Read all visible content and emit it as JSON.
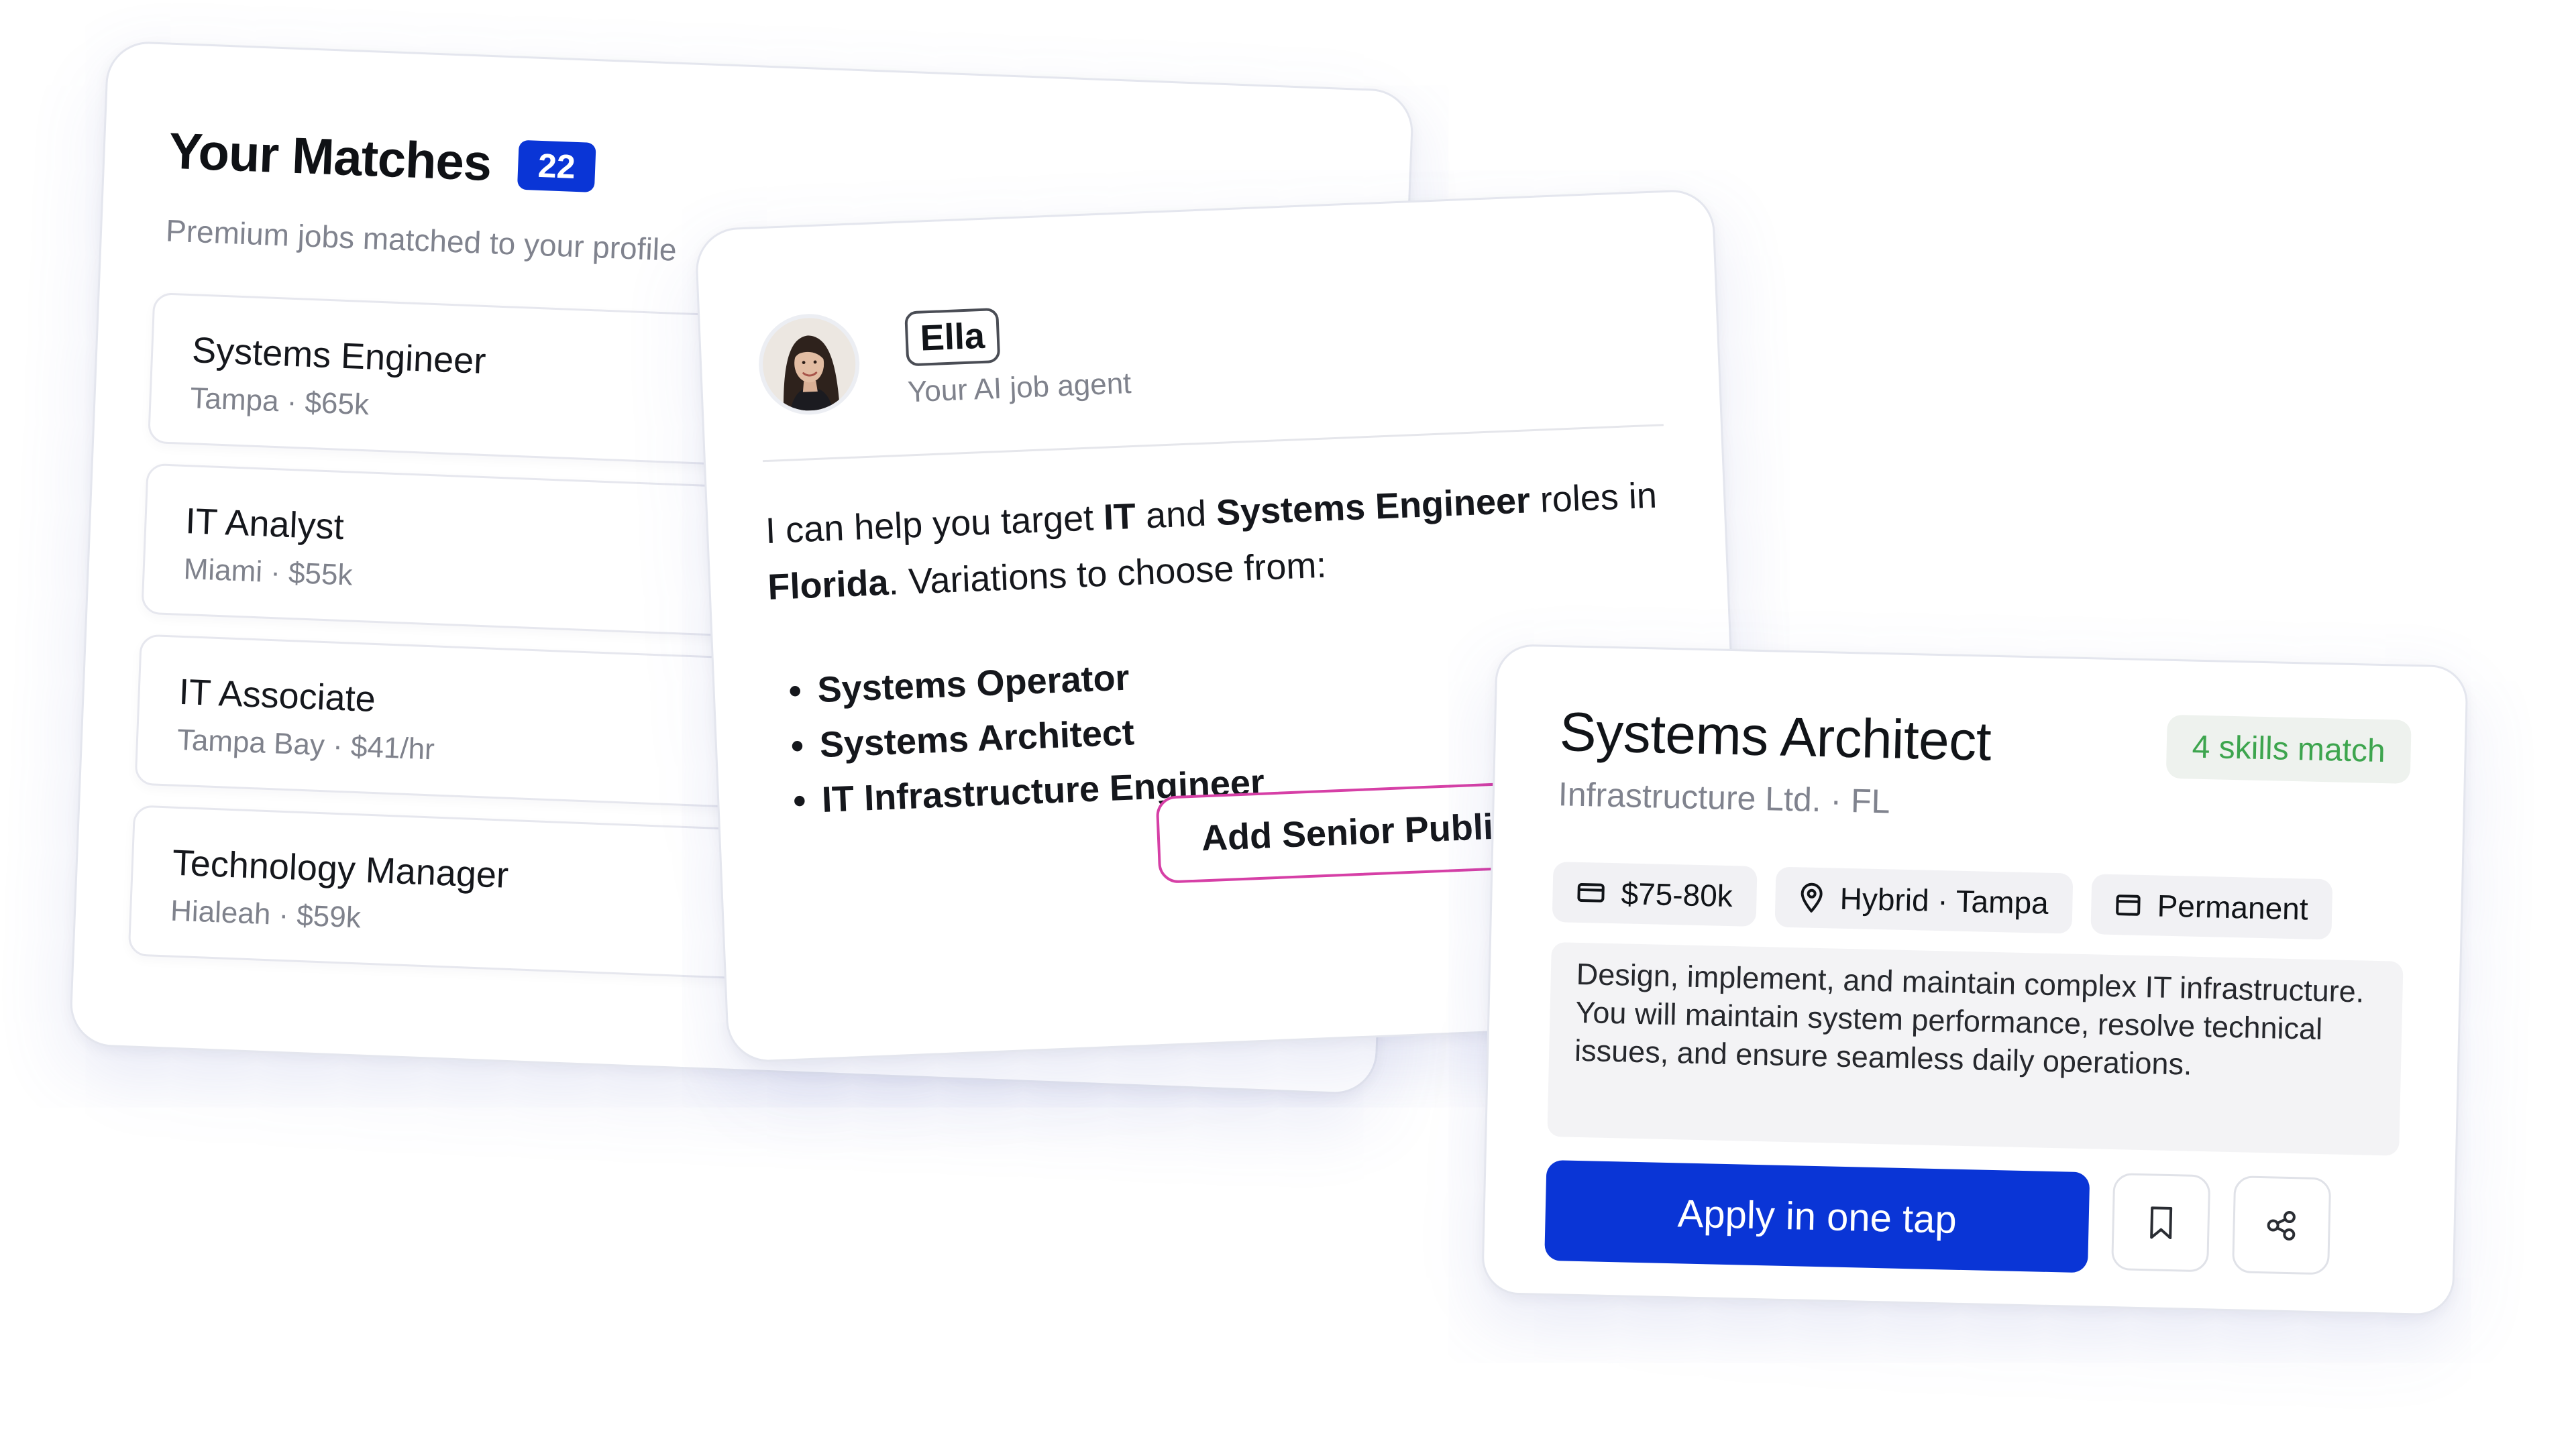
{
  "matches": {
    "title": "Your Matches",
    "count": "22",
    "subtitle": "Premium jobs matched to your profile",
    "items": [
      {
        "title": "Systems Engineer",
        "meta": "Tampa · $65k"
      },
      {
        "title": "IT Analyst",
        "meta": "Miami · $55k"
      },
      {
        "title": "IT Associate",
        "meta": "Tampa Bay · $41/hr"
      },
      {
        "title": "Technology Manager",
        "meta": "Hialeah · $59k"
      }
    ]
  },
  "agent": {
    "name": "Ella",
    "role": "Your AI job agent",
    "message": {
      "p1": "I can help you target ",
      "b1": "IT",
      "p2": " and ",
      "b2": "Systems Engineer",
      "p3": " roles in ",
      "b3": "Florida",
      "p4": ". Variations to choose from:"
    },
    "variations": [
      "Systems Operator",
      "Systems Architect",
      "IT Infrastructure Engineer"
    ],
    "add_button": "Add Senior Public"
  },
  "job": {
    "title": "Systems Architect",
    "company": "Infrastructure Ltd. · FL",
    "skills_badge": "4 skills match",
    "salary": "$75-80k",
    "location": "Hybrid · Tampa",
    "type": "Permanent",
    "description": "Design, implement, and maintain complex IT infrastructure. You will maintain system performance, resolve technical issues, and ensure seamless daily operations.",
    "apply_label": "Apply in one tap",
    "icons": {
      "salary": "wallet-icon",
      "location": "map-pin-icon",
      "type": "briefcase-icon",
      "save": "bookmark-icon",
      "share": "share-icon"
    }
  },
  "colors": {
    "primary": "#0a35d6",
    "success_text": "#3da54e",
    "success_bg": "#eef2ee",
    "accent_border": "#d63fa6",
    "muted_text": "#80838e"
  }
}
